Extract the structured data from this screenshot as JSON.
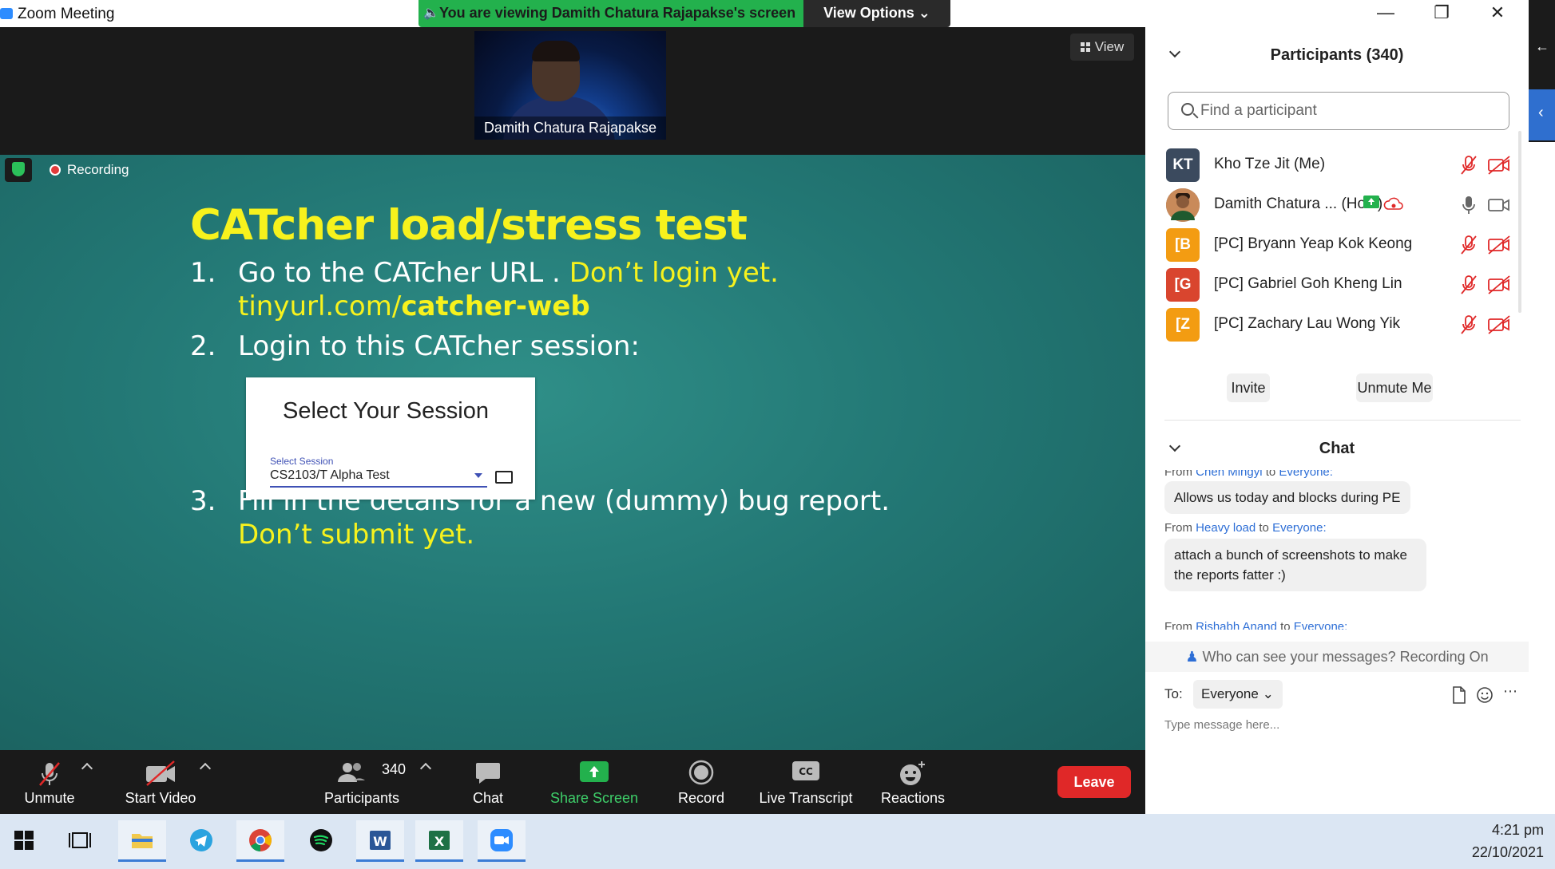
{
  "window": {
    "title": "Zoom Meeting"
  },
  "share_banner": {
    "message": "You are viewing Damith Chatura Rajapakse's screen",
    "view_options": "View Options"
  },
  "video": {
    "speaker_name": "Damith Chatura Rajapakse",
    "view_label": "View"
  },
  "recording_label": "Recording",
  "slide": {
    "title": "CATcher load/stress test",
    "step1_num": "1.",
    "step1_a": "Go to the CATcher URL . ",
    "step1_b": "Don’t login yet.",
    "step1_c": "tinyurl.com/",
    "step1_d": "catcher-web",
    "step2_num": "2.",
    "step2": "Login to this CATcher session:",
    "card_title": "Select Your Session",
    "card_label": "Select Session",
    "card_value": "CS2103/T Alpha Test",
    "step3_num": "3.",
    "step3_a": "Fill in the details for a new (dummy) bug report.",
    "step3_b": "Don’t submit yet."
  },
  "toolbar": {
    "unmute": "Unmute",
    "start_video": "Start Video",
    "participants": "Participants",
    "participant_count": "340",
    "chat": "Chat",
    "share_screen": "Share Screen",
    "record": "Record",
    "live_transcript": "Live Transcript",
    "reactions": "Reactions",
    "leave": "Leave"
  },
  "participants_panel": {
    "title": "Participants (340)",
    "search_placeholder": "Find a participant",
    "rows": [
      {
        "initials": "KT",
        "name": "Kho Tze Jit (Me)",
        "color": "#3b4a5e"
      },
      {
        "initials": "",
        "name": "Damith Chatura ...  (Host)",
        "color": "#7a5032"
      },
      {
        "initials": "[B",
        "name": "[PC] Bryann Yeap Kok Keong",
        "color": "#f39c12"
      },
      {
        "initials": "[G",
        "name": "[PC] Gabriel Goh Kheng Lin",
        "color": "#d9452e"
      },
      {
        "initials": "[Z",
        "name": "[PC] Zachary Lau Wong Yik",
        "color": "#f39c12"
      }
    ],
    "invite": "Invite",
    "unmute_me": "Unmute Me"
  },
  "chat_panel": {
    "title": "Chat",
    "messages": [
      {
        "from_prefix": "From ",
        "from": "Chen Mingyi",
        "to_prefix": " to ",
        "to": "Everyone:",
        "text": "Allows us today and blocks during PE"
      },
      {
        "from_prefix": "From ",
        "from": "Heavy load",
        "to_prefix": " to ",
        "to": "Everyone:",
        "text": "attach a bunch of screenshots to make the reports fatter :)"
      },
      {
        "from_prefix": "From ",
        "from": "Rishabh Anand",
        "to_prefix": " to ",
        "to": "Everyone:",
        "text": ""
      }
    ],
    "visibility_note": "Who can see your messages? Recording On",
    "to_label": "To:",
    "recipient": "Everyone",
    "input_placeholder": "Type message here..."
  },
  "taskbar": {
    "time": "4:21 pm",
    "date": "22/10/2021"
  },
  "colors": {
    "zoom_blue": "#2d8cff",
    "share_green": "#23b14d",
    "leave_red": "#e02828",
    "slide_teal": "#237875",
    "slide_yellow": "#f7f21d"
  }
}
